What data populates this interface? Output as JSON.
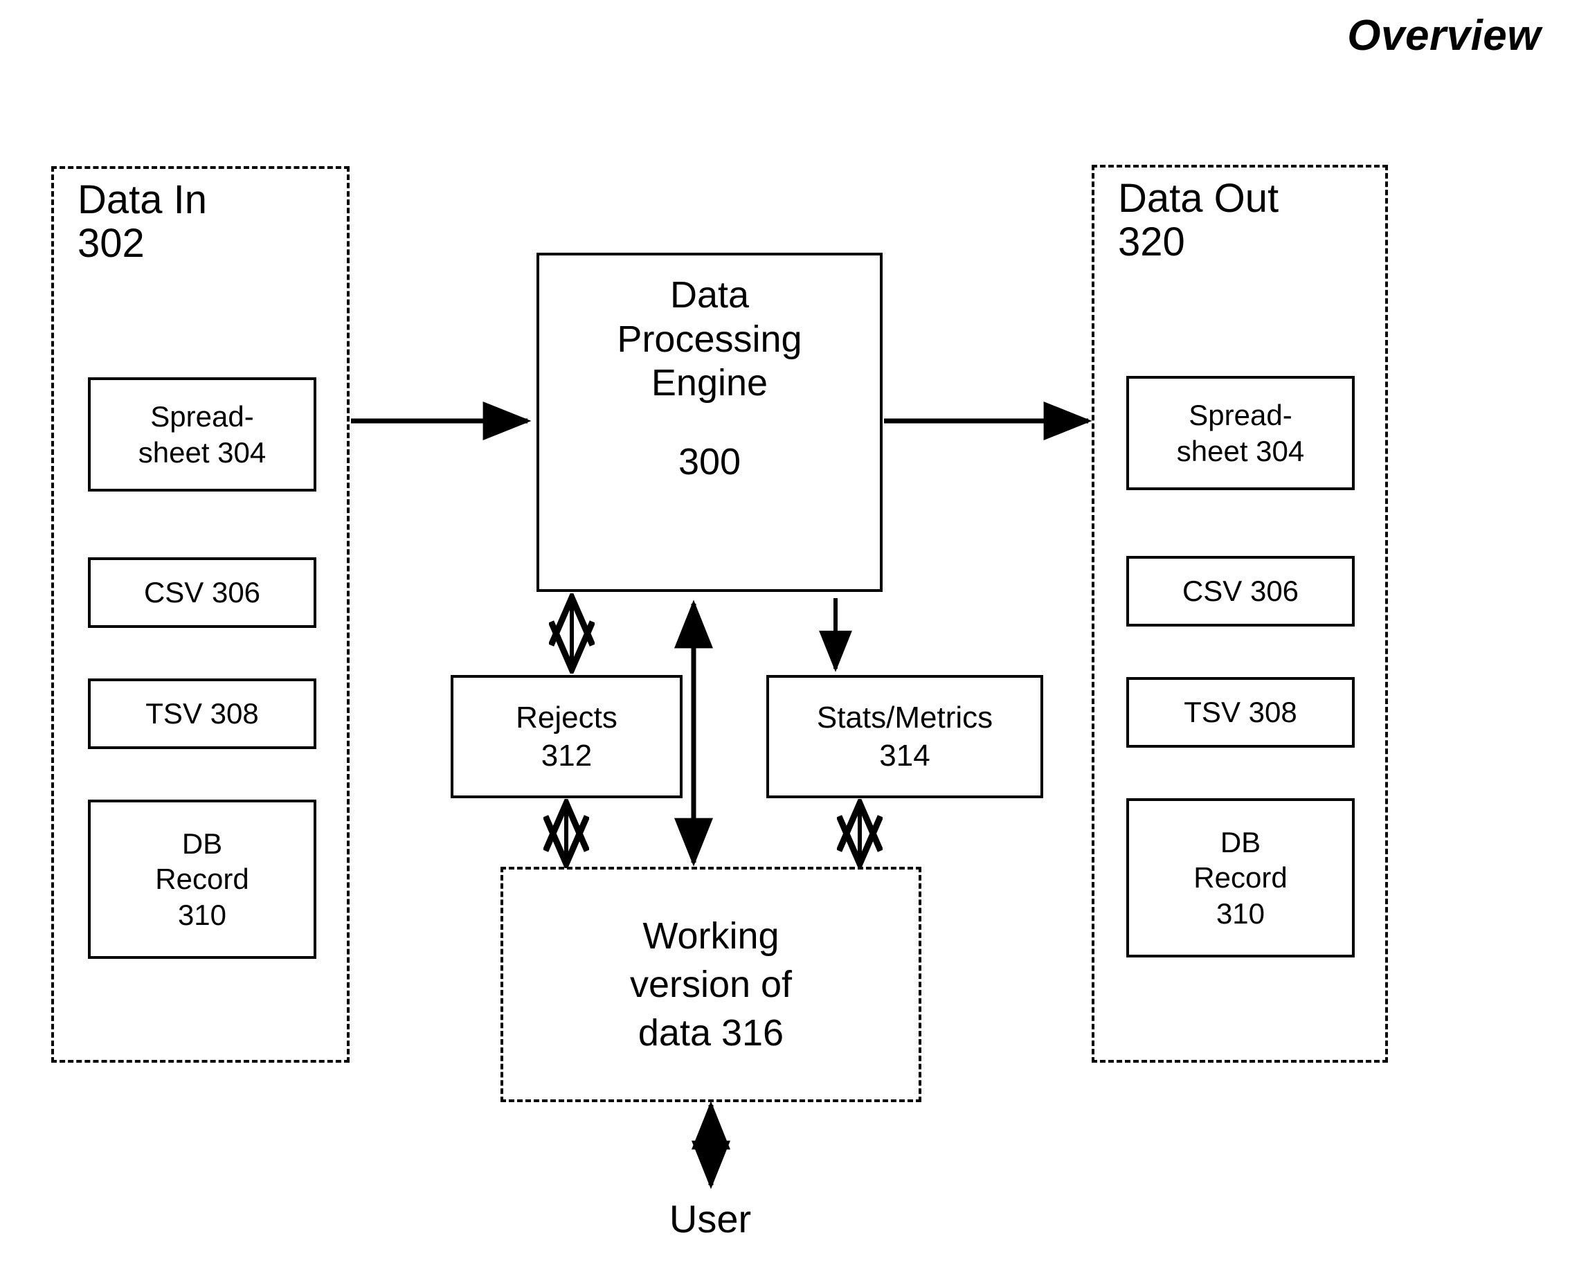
{
  "figure": {
    "title": "Overview",
    "type": "block-diagram"
  },
  "data_in": {
    "title": "Data In\n302",
    "items": [
      {
        "label": "Spread-\nsheet 304"
      },
      {
        "label": "CSV 306"
      },
      {
        "label": "TSV 308"
      },
      {
        "label": "DB\nRecord\n310"
      }
    ]
  },
  "data_out": {
    "title": "Data Out\n320",
    "items": [
      {
        "label": "Spread-\nsheet 304"
      },
      {
        "label": "CSV 306"
      },
      {
        "label": "TSV 308"
      },
      {
        "label": "DB\nRecord\n310"
      }
    ]
  },
  "engine": {
    "name": "Data\nProcessing\nEngine",
    "number": "300"
  },
  "rejects": {
    "label": "Rejects\n312"
  },
  "stats": {
    "label": "Stats/Metrics\n314"
  },
  "working": {
    "label": "Working\nversion of\ndata 316"
  },
  "user": {
    "label": "User"
  },
  "colors": {
    "stroke": "#000000",
    "background": "#ffffff"
  }
}
